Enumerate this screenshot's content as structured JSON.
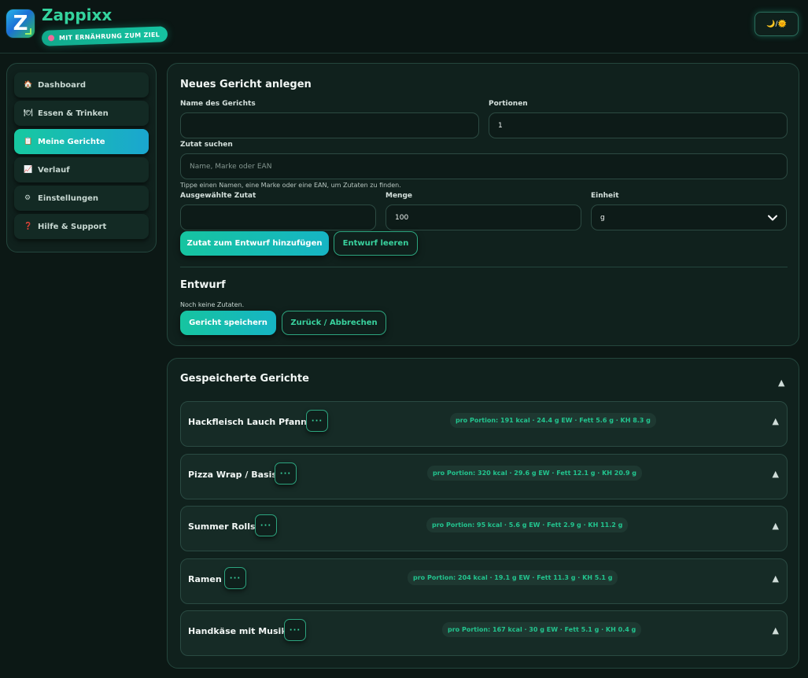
{
  "header": {
    "app_name": "Zappixx",
    "logo_letter": "Z",
    "tagline": "MIT ERNÄHRUNG ZUM ZIEL",
    "theme_toggle": "🌙/🌞"
  },
  "sidebar": {
    "items": [
      {
        "icon": "🏠",
        "icon_name": "home-icon",
        "label": "Dashboard",
        "active": false
      },
      {
        "icon": "🍽",
        "icon_name": "plate-icon",
        "label": "Essen & Trinken",
        "active": false
      },
      {
        "icon": "📋",
        "icon_name": "clipboard-icon",
        "label": "Meine Gerichte",
        "active": true
      },
      {
        "icon": "📈",
        "icon_name": "chart-icon",
        "label": "Verlauf",
        "active": false
      },
      {
        "icon": "⚙",
        "icon_name": "gear-icon",
        "label": "Einstellungen",
        "active": false
      },
      {
        "icon": "❓",
        "icon_name": "question-icon",
        "label": "Hilfe & Support",
        "active": false
      }
    ]
  },
  "new_dish": {
    "title": "Neues Gericht anlegen",
    "name_label": "Name des Gerichts",
    "name_value": "",
    "portions_label": "Portionen",
    "portions_value": "1",
    "search_label": "Zutat suchen",
    "search_placeholder": "Name, Marke oder EAN",
    "search_hint": "Tippe einen Namen, eine Marke oder eine EAN, um Zutaten zu finden.",
    "selected_label": "Ausgewählte Zutat",
    "selected_value": "",
    "amount_label": "Menge",
    "amount_value": "100",
    "unit_label": "Einheit",
    "unit_value": "g",
    "add_button": "Zutat zum Entwurf hinzufügen",
    "clear_button": "Entwurf leeren"
  },
  "draft": {
    "title": "Entwurf",
    "empty_text": "Noch keine Zutaten.",
    "save_button": "Gericht speichern",
    "cancel_button": "Zurück / Abbrechen"
  },
  "saved": {
    "title": "Gespeicherte Gerichte",
    "collapse_icon": "▲",
    "menu_label": "···",
    "dishes": [
      {
        "name": "Hackfleisch Lauch Pfanne",
        "summary": "pro Portion: 191 kcal · 24.4 g EW · Fett 5.6 g · KH 8.3 g"
      },
      {
        "name": "Pizza Wrap / Basis",
        "summary": "pro Portion: 320 kcal · 29.6 g EW · Fett 12.1 g · KH 20.9 g"
      },
      {
        "name": "Summer Rolls",
        "summary": "pro Portion: 95 kcal · 5.6 g EW · Fett 2.9 g · KH 11.2 g"
      },
      {
        "name": "Ramen",
        "summary": "pro Portion: 204 kcal · 19.1 g EW · Fett 11.3 g · KH 5.1 g"
      },
      {
        "name": "Handkäse mit Musik",
        "summary": "pro Portion: 167 kcal · 30 g EW · Fett 5.1 g · KH 0.4 g"
      }
    ]
  }
}
